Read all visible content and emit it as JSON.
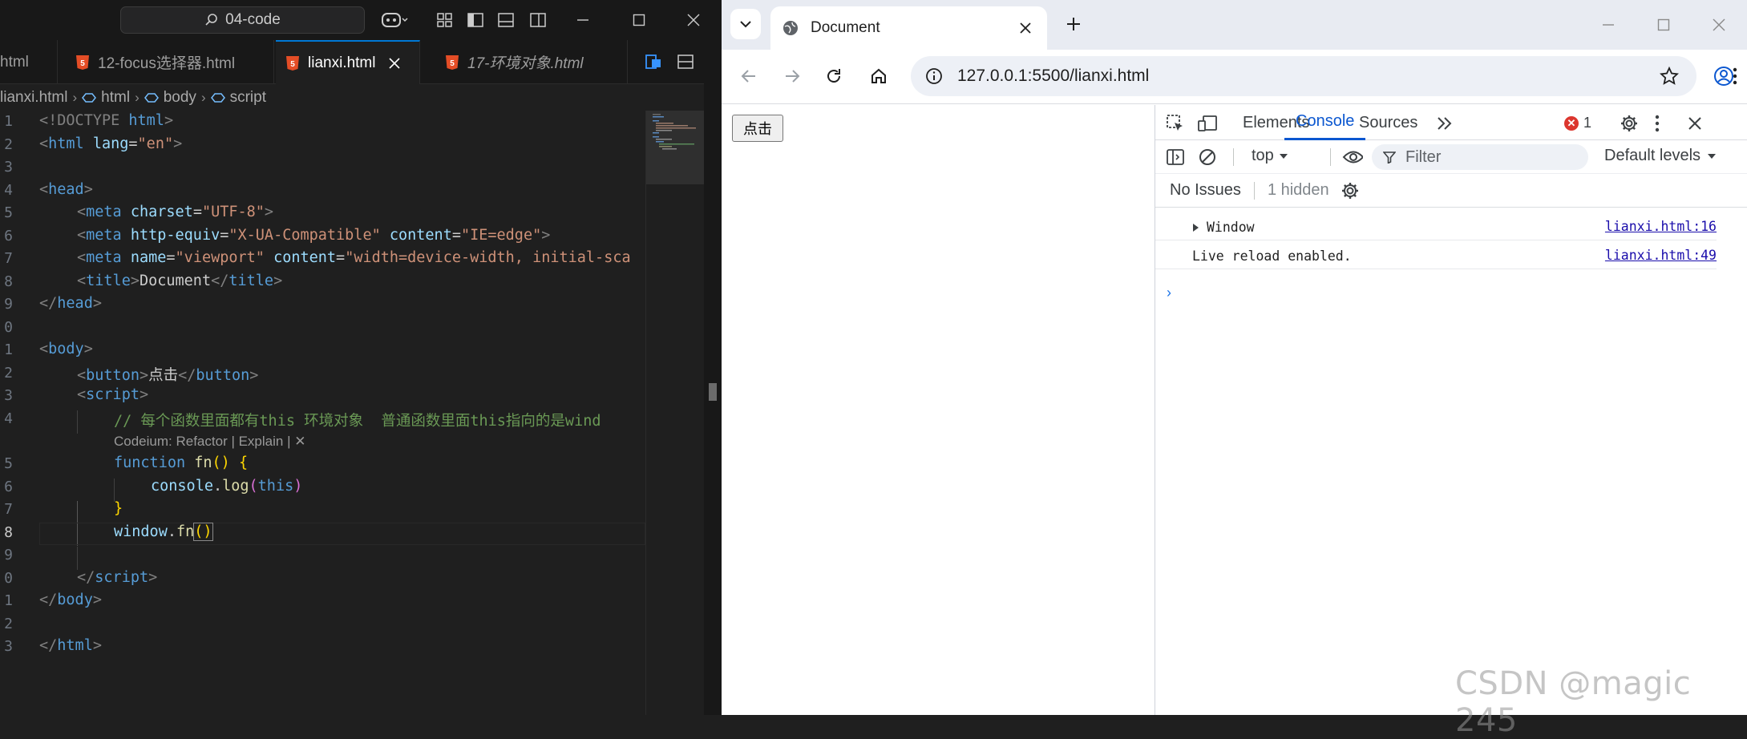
{
  "editor": {
    "command_center": "04-code",
    "tabs": [
      {
        "label": "html"
      },
      {
        "label": "12-focus选择器.html"
      },
      {
        "label": "lianxi.html"
      },
      {
        "label": "17-环境对象.html"
      }
    ],
    "breadcrumb": [
      "lianxi.html",
      "html",
      "body",
      "script"
    ],
    "line_numbers": [
      "1",
      "2",
      "3",
      "4",
      "5",
      "6",
      "7",
      "8",
      "9",
      "0",
      "1",
      "2",
      "3",
      "4",
      "5",
      "6",
      "7",
      "8",
      "9",
      "0",
      "1",
      "2",
      "3"
    ],
    "code": {
      "l1_a": "<!DOCTYPE ",
      "l1_b": "html",
      "l1_c": ">",
      "l2_a": "<",
      "l2_b": "html",
      "l2_c": " lang",
      "l2_d": "=",
      "l2_e": "\"en\"",
      "l2_f": ">",
      "l4_a": "<",
      "l4_b": "head",
      "l4_c": ">",
      "l5_a": "<",
      "l5_b": "meta",
      "l5_c": " charset",
      "l5_d": "=",
      "l5_e": "\"UTF-8\"",
      "l5_f": ">",
      "l6_a": "<",
      "l6_b": "meta",
      "l6_c": " http-equiv",
      "l6_d": "=",
      "l6_e": "\"X-UA-Compatible\"",
      "l6_f": " content",
      "l6_g": "=",
      "l6_h": "\"IE=edge\"",
      "l6_i": ">",
      "l7_a": "<",
      "l7_b": "meta",
      "l7_c": " name",
      "l7_d": "=",
      "l7_e": "\"viewport\"",
      "l7_f": " content",
      "l7_g": "=",
      "l7_h": "\"width=device-width, initial-sca",
      "l8_a": "<",
      "l8_b": "title",
      "l8_c": ">",
      "l8_d": "Document",
      "l8_e": "</",
      "l8_f": "title",
      "l8_g": ">",
      "l9_a": "</",
      "l9_b": "head",
      "l9_c": ">",
      "l11_a": "<",
      "l11_b": "body",
      "l11_c": ">",
      "l12_a": "<",
      "l12_b": "button",
      "l12_c": ">",
      "l12_d": "点击",
      "l12_e": "</",
      "l12_f": "button",
      "l12_g": ">",
      "l13_a": "<",
      "l13_b": "script",
      "l13_c": ">",
      "l14": "// 每个函数里面都有this 环境对象  普通函数里面this指向的是wind",
      "codelens": "Codeium: Refactor | Explain | ✕",
      "l15_a": "function",
      "l15_b": " fn",
      "l15_c": "() {",
      "l16_a": "console",
      "l16_b": ".",
      "l16_c": "log",
      "l16_d": "(",
      "l16_e": "this",
      "l16_f": ")",
      "l17": "}",
      "l18_a": "window",
      "l18_b": ".",
      "l18_c": "fn",
      "l18_d": "()",
      "l20_a": "</",
      "l20_b": "script",
      "l20_c": ">",
      "l21_a": "</",
      "l21_b": "body",
      "l21_c": ">",
      "l23_a": "</",
      "l23_b": "html",
      "l23_c": ">"
    }
  },
  "browser": {
    "tab_title": "Document",
    "url": "127.0.0.1:5500/lianxi.html",
    "page_button": "点击",
    "devtools": {
      "tabs": [
        "Elements",
        "Console",
        "Sources"
      ],
      "error_count": "1",
      "context": "top",
      "filter_placeholder": "Filter",
      "levels": "Default levels",
      "no_issues": "No Issues",
      "hidden": "1 hidden",
      "messages": [
        {
          "text": "Window",
          "source": "lianxi.html:16"
        },
        {
          "text": "Live reload enabled.",
          "source": "lianxi.html:49"
        }
      ]
    }
  },
  "watermark": "CSDN @magic 245"
}
